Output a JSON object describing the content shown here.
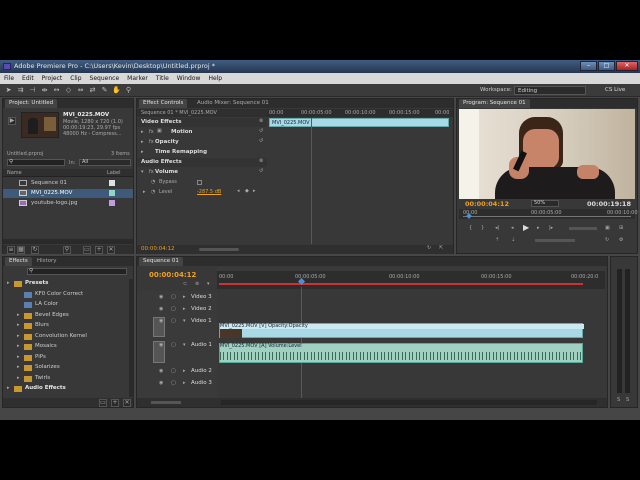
{
  "window": {
    "title": "Adobe Premiere Pro - C:\\Users\\Kevin\\Desktop\\Untitled.prproj *",
    "controls": [
      "–",
      "□",
      "✕"
    ]
  },
  "menu": [
    "File",
    "Edit",
    "Project",
    "Clip",
    "Sequence",
    "Marker",
    "Title",
    "Window",
    "Help"
  ],
  "toolbar": {
    "workspace_label": "Workspace:",
    "workspace_value": "Editing",
    "cs_live": "CS Live"
  },
  "project": {
    "tab": "Project: Untitled",
    "clip_name": "MVI_0225.MOV",
    "clip_line1": "Movie, 1280 x 720 (1.0)",
    "clip_line2": "00:00:19:23, 29.97 fps",
    "clip_line3": "48000 Hz - Compress...",
    "project_file": "Untitled.prproj",
    "items_count": "3 Items",
    "in_label": "In:",
    "in_value": "All",
    "col_name": "Name",
    "col_label": "Label",
    "items": [
      {
        "name": "Sequence 01"
      },
      {
        "name": "MVI_0225.MOV"
      },
      {
        "name": "youtube-logo.jpg"
      }
    ]
  },
  "effect_controls": {
    "tab_active": "Effect Controls",
    "tab_other": "Audio Mixer: Sequence 01",
    "clip_header": "Sequence 01 * MVI_0225.MOV",
    "video_effects": "Video Effects",
    "motion": "Motion",
    "opacity": "Opacity",
    "time_remapping": "Time Remapping",
    "audio_effects": "Audio Effects",
    "volume": "Volume",
    "bypass": "Bypass",
    "level": "Level",
    "level_value": "-287.5 dB",
    "ruler_times": [
      "00:00",
      "00:00:05:00",
      "00:00:10:00",
      "00:00:15:00",
      "00:00"
    ],
    "clip_bar_label": "MVI_0225.MOV",
    "timecode": "00:00:04:12"
  },
  "program": {
    "tab": "Program: Sequence 01",
    "timecode_current": "00:00:04:12",
    "fit": "50%",
    "timecode_total": "00:00:19:18",
    "ruler_times": [
      "00:00",
      "00:00:05:00",
      "00:00:10:00"
    ]
  },
  "effects_panel": {
    "tab_active": "Effects",
    "tab_other": "History",
    "tree": [
      {
        "label": "Presets",
        "level": 0,
        "folder": true
      },
      {
        "label": "KF0 Color Correct",
        "level": 1,
        "folder": false
      },
      {
        "label": "LA Color",
        "level": 1,
        "folder": false
      },
      {
        "label": "Bevel Edges",
        "level": 1,
        "folder": true
      },
      {
        "label": "Blurs",
        "level": 1,
        "folder": true
      },
      {
        "label": "Convolution Kernel",
        "level": 1,
        "folder": true
      },
      {
        "label": "Mosaics",
        "level": 1,
        "folder": true
      },
      {
        "label": "PiPs",
        "level": 1,
        "folder": true
      },
      {
        "label": "Solarizes",
        "level": 1,
        "folder": true
      },
      {
        "label": "Twirls",
        "level": 1,
        "folder": true
      },
      {
        "label": "Audio Effects",
        "level": 0,
        "folder": true
      }
    ]
  },
  "timeline": {
    "tab": "Sequence 01",
    "timecode": "00:00:04:12",
    "ruler_times": [
      "00:00",
      "00:00:05:00",
      "00:00:10:00",
      "00:00:15:00",
      "00:00:20:0"
    ],
    "tracks": {
      "video3": "Video 3",
      "video2": "Video 2",
      "video1": "Video 1",
      "audio1": "Audio 1",
      "audio2": "Audio 2",
      "audio3": "Audio 3"
    },
    "video_clip_label": "MVI_0225.MOV [V]  Opacity:Opacity",
    "audio_clip_label": "MVI_0225.MOV [A]  Volume:Level"
  },
  "colors": {
    "accent_cyan": "#2ad0ee",
    "timecode_orange": "#f0a020",
    "clip_video": "#a9d9e6",
    "clip_audio": "#9fd0c0",
    "playhead": "#e02020"
  }
}
